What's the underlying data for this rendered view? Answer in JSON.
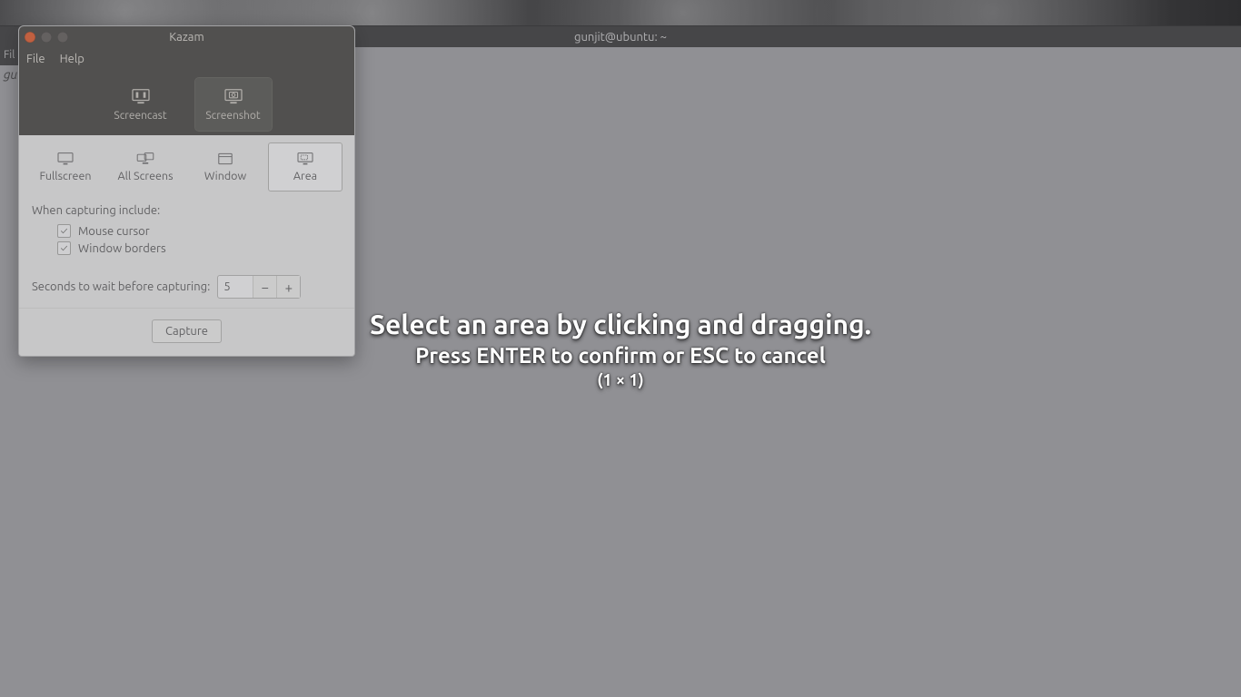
{
  "desktop": {
    "terminal_title": "gunjit@ubuntu: ~",
    "behind_menu": "Fil",
    "behind_text": "gu"
  },
  "kazam": {
    "title": "Kazam",
    "menu": {
      "file": "File",
      "help": "Help"
    },
    "modes": {
      "screencast": "Screencast",
      "screenshot": "Screenshot"
    },
    "targets": {
      "fullscreen": "Fullscreen",
      "all_screens": "All Screens",
      "window": "Window",
      "area": "Area"
    },
    "include_label": "When capturing include:",
    "checks": {
      "mouse": "Mouse cursor",
      "borders": "Window borders"
    },
    "wait_label": "Seconds to wait before capturing:",
    "wait_value": "5",
    "capture": "Capture"
  },
  "overlay": {
    "line1": "Select an area by clicking and dragging.",
    "line2": "Press ENTER to confirm or ESC to cancel",
    "line3": "(1 × 1)"
  }
}
